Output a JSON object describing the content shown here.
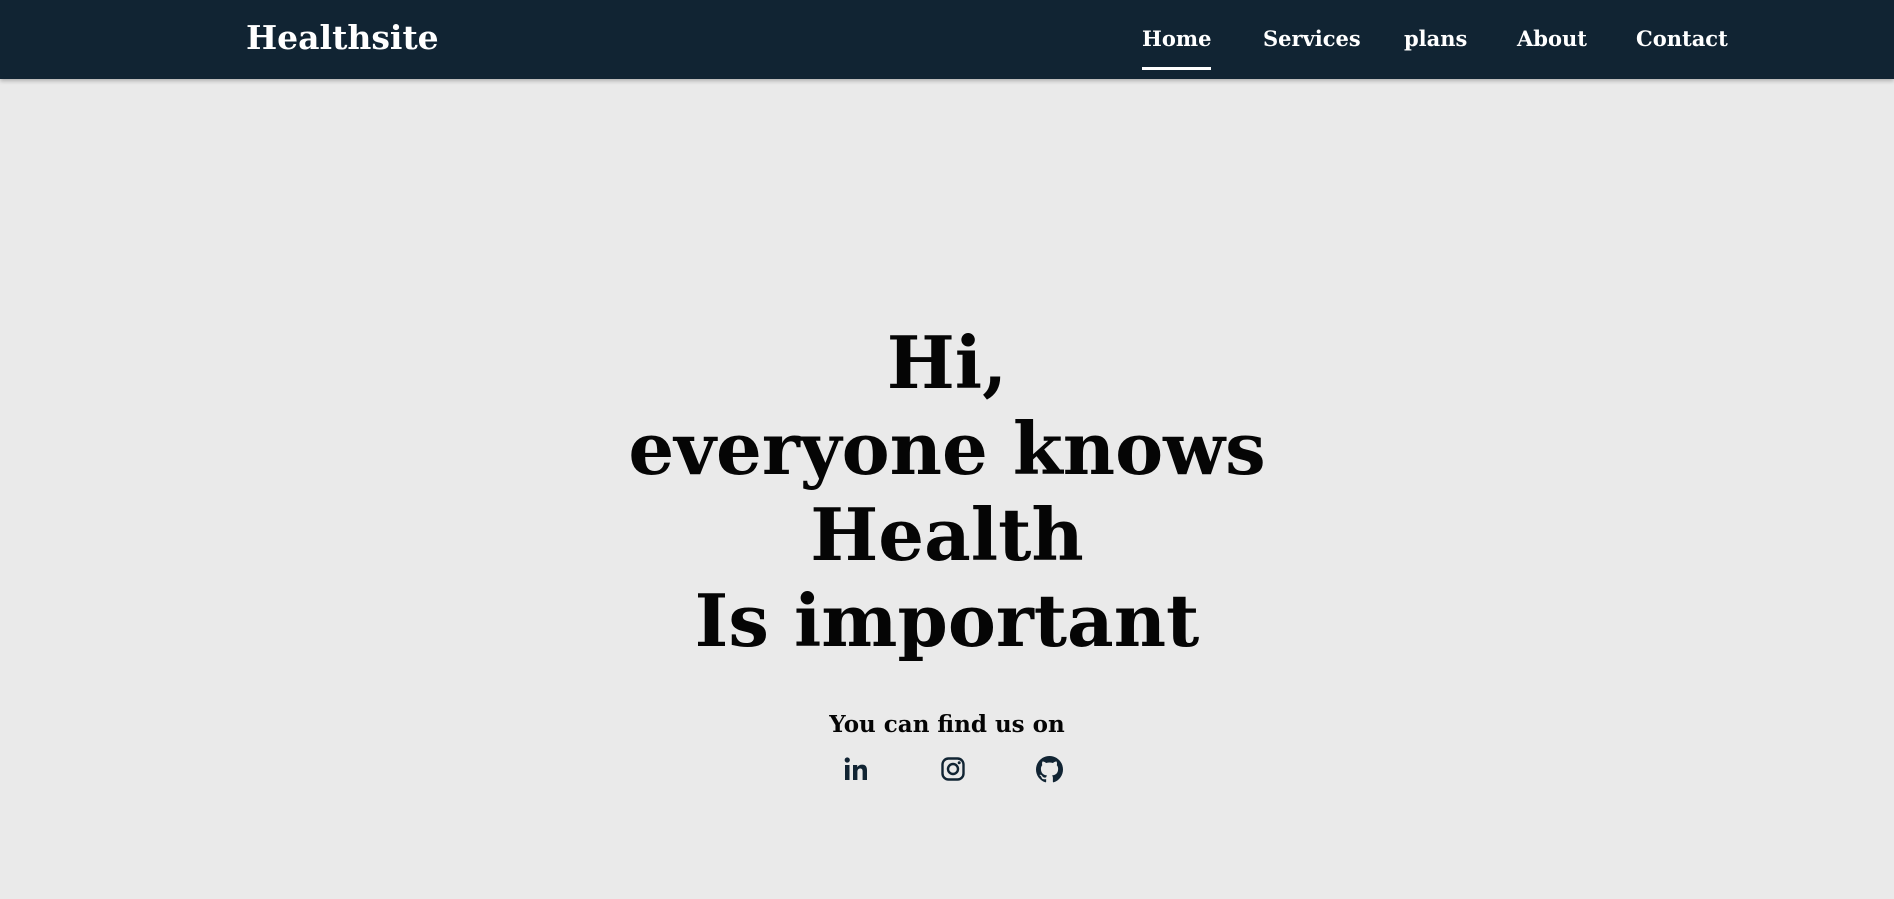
{
  "brand": {
    "name": "Healthsite"
  },
  "nav": {
    "items": [
      {
        "label": "Home",
        "active": true
      },
      {
        "label": "Services",
        "active": false
      },
      {
        "label": "plans",
        "active": false
      },
      {
        "label": "About",
        "active": false
      },
      {
        "label": "Contact",
        "active": false
      }
    ]
  },
  "hero": {
    "lines": [
      "Hi,",
      "everyone knows",
      "Health",
      "Is important"
    ]
  },
  "social": {
    "heading": "You can find us on",
    "icons": [
      "linkedin-icon",
      "instagram-icon",
      "github-icon"
    ]
  },
  "colors": {
    "navbar_bg": "#112433",
    "page_bg": "#eaeaea",
    "text_dark": "#050505",
    "icon_color": "#112433",
    "nav_text": "#ffffff"
  }
}
